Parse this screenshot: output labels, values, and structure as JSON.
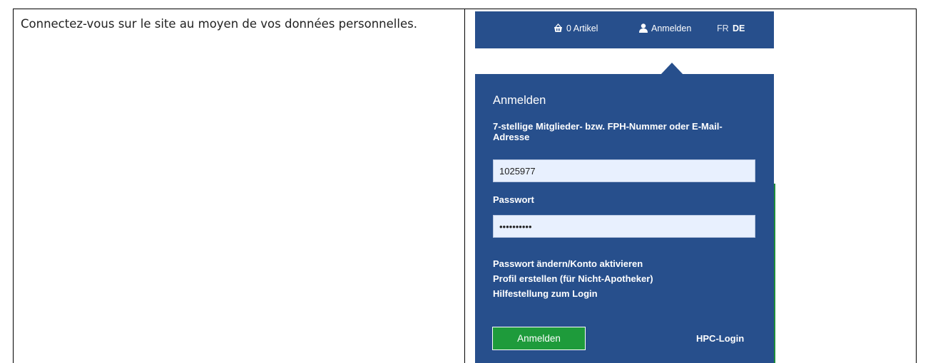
{
  "instruction": "Connectez-vous sur le site au moyen de vos données personnelles.",
  "header": {
    "cart_label": "0 Artikel",
    "login_label": "Anmelden",
    "lang_fr": "FR",
    "lang_de": "DE",
    "cart_icon": "basket-icon",
    "user_icon": "user-icon"
  },
  "login_panel": {
    "title": "Anmelden",
    "id_label": "7-stellige Mitglieder- bzw. FPH-Nummer oder E-Mail-Adresse",
    "id_value": "1025977",
    "password_label": "Passwort",
    "password_value": "••••••••••",
    "links": [
      "Passwort ändern/Konto aktivieren",
      "Profil erstellen (für Nicht-Apotheker)",
      "Hilfestellung zum Login"
    ],
    "submit_label": "Anmelden",
    "hpc_label": "HPC-Login"
  },
  "colors": {
    "brand_blue": "#274f8c",
    "button_green": "#1e9b3b",
    "field_bg": "#e8f0fe"
  }
}
